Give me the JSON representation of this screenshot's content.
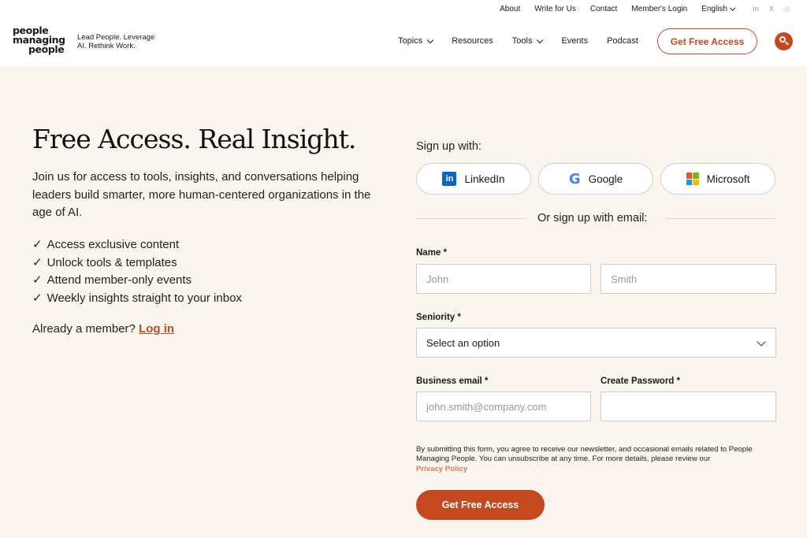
{
  "topbar": {
    "about": "About",
    "write_for_us": "Write for Us",
    "contact": "Contact",
    "member_login": "Member's Login",
    "language": "English",
    "social": [
      "in",
      "X",
      "◎"
    ]
  },
  "brand": {
    "logo_line1": "people",
    "logo_line2": "managing",
    "logo_line3": "people",
    "tagline_line1": "Lead People. Leverage",
    "tagline_line2": "AI. Rethink Work."
  },
  "nav": {
    "topics": "Topics",
    "resources": "Resources",
    "tools": "Tools",
    "events": "Events",
    "podcast": "Podcast",
    "cta": "Get Free Access"
  },
  "hero": {
    "title": "Free Access. Real Insight.",
    "intro": "Join us for access to tools, insights, and conversations helping leaders build smarter, more human-centered organizations in the age of AI.",
    "benefits": [
      "Access exclusive content",
      "Unlock tools & templates",
      "Attend member-only events",
      "Weekly insights straight to your inbox"
    ],
    "check": "✓",
    "member_prompt": "Already a member?",
    "login_link": "Log in"
  },
  "form": {
    "signup_with": "Sign up with:",
    "linkedin": "LinkedIn",
    "google": "Google",
    "microsoft": "Microsoft",
    "or_email": "Or sign up with email:",
    "name_label": "Name *",
    "first_placeholder": "John",
    "last_placeholder": "Smith",
    "seniority_label": "Seniority *",
    "seniority_value": "Select an option",
    "email_label": "Business email *",
    "email_placeholder": "john.smith@company.com",
    "password_label": "Create Password *",
    "legal_text": "By submitting this form, you agree to receive our newsletter, and occasional emails related to People Managing People. You can unsubscribe at any time. For more details, please review our",
    "privacy_link": "Privacy Policy",
    "submit": "Get Free Access"
  },
  "colors": {
    "accent": "#c5481e",
    "page_bg": "#faf5ee",
    "header_bg": "#ffffff"
  }
}
